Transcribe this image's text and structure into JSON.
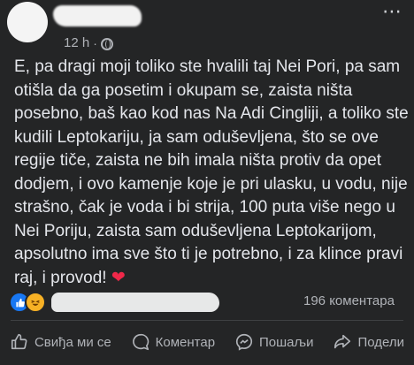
{
  "post": {
    "timestamp": "12 h",
    "separator": "·",
    "more_icon": "⋯",
    "text": "E, pa dragi moji toliko ste hvalili taj Nei Pori, pa sam otišla da ga posetim i okupam se, zaista ništa posebno, baš kao kod nas Na Adi Cingliji, a toliko ste kudili Leptokariju, ja sam oduševljena, što se ove regije tiče, zaista ne bih imala ništa protiv da opet dodjem, i ovo kamenje koje je pri ulasku, u vodu, nije strašno, čak je voda i bi strija, 100 puta više nego u Nei Poriju, zaista sam oduševljena Leptokarijom, apsolutno ima sve što ti je potrebno, i za klince pravi raj, i provod!",
    "heart": "❤",
    "comments": "196 коментара"
  },
  "actions": {
    "like": "Свиђа ми се",
    "comment": "Коментар",
    "share": "Пошаљи",
    "forward": "Подели"
  },
  "colors": {
    "background": "#242526",
    "text": "#e4e6eb",
    "muted": "#b0b3b8",
    "like_blue": "#1877f2",
    "haha_yellow": "#f7b125",
    "heart_red": "#f02849"
  }
}
